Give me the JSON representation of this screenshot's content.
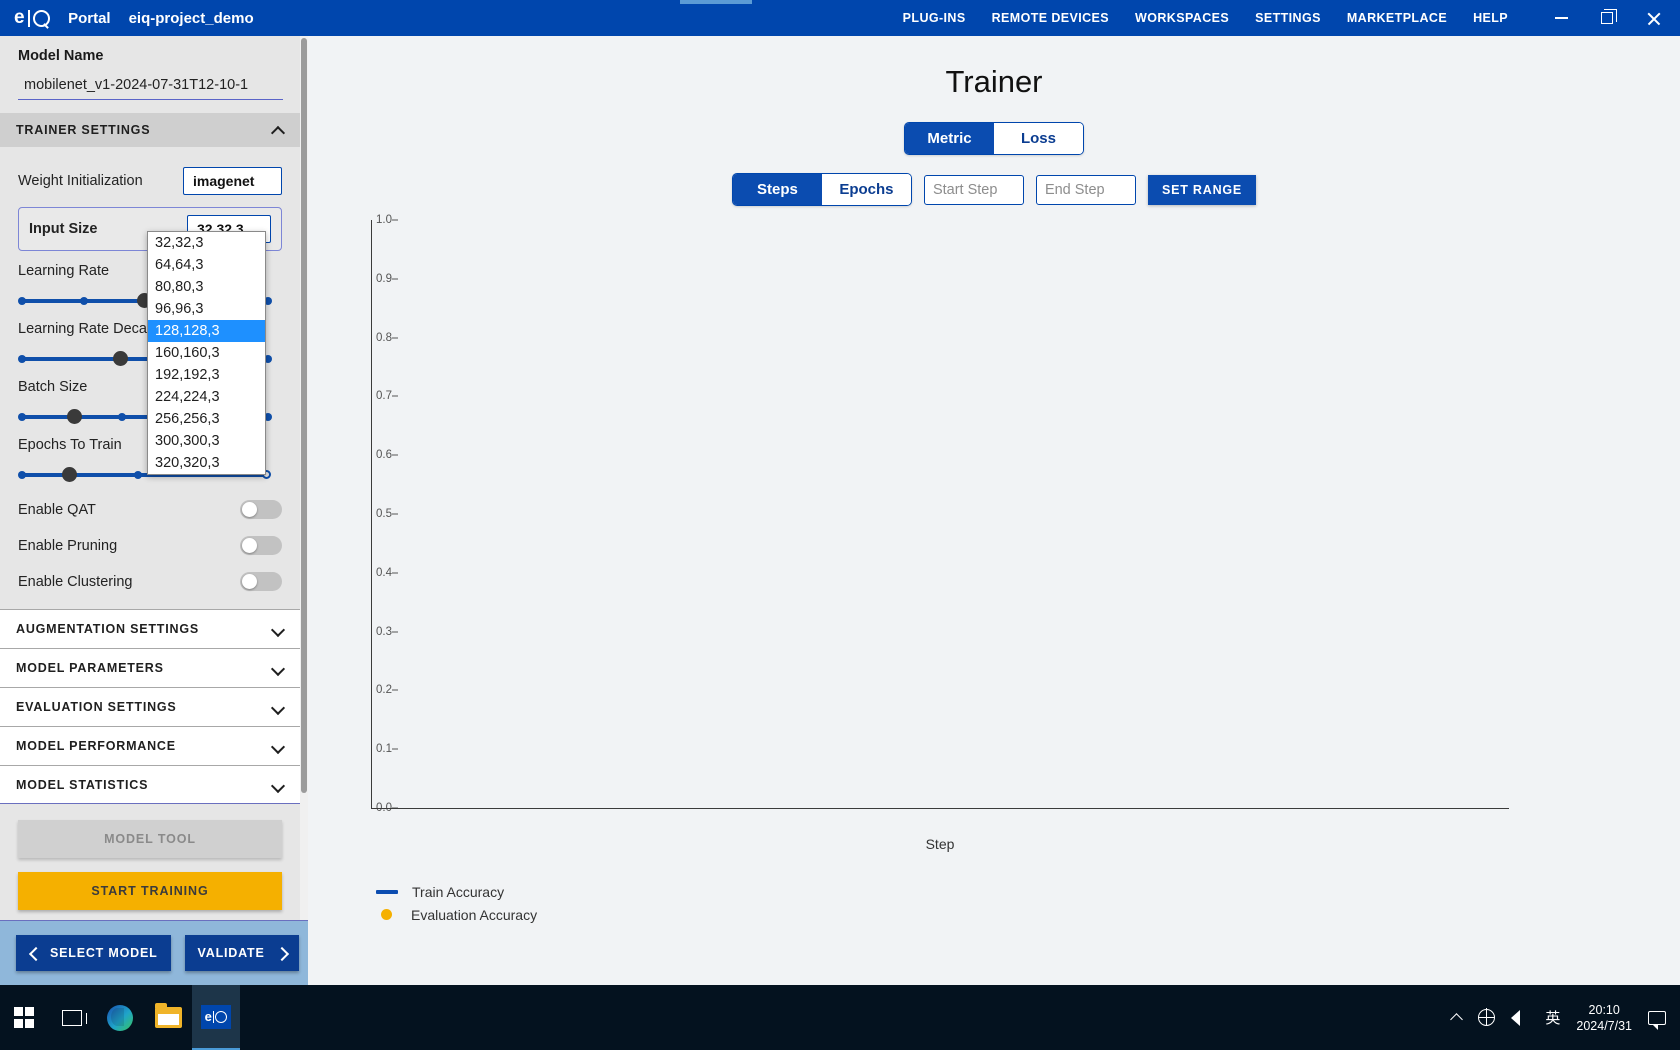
{
  "titlebar": {
    "logo_text": "eIQ",
    "product": "Portal",
    "project": "eiq-project_demo",
    "nav_items": [
      "PLUG-INS",
      "REMOTE DEVICES",
      "WORKSPACES",
      "SETTINGS",
      "MARKETPLACE",
      "HELP"
    ],
    "window_controls": [
      "minimize-icon",
      "restore-icon",
      "close-icon"
    ]
  },
  "sidebar": {
    "model_name_label": "Model Name",
    "model_name_value": "mobilenet_v1-2024-07-31T12-10-1",
    "trainer_settings_header": "TRAINER SETTINGS",
    "weight_init_label": "Weight Initialization",
    "weight_init_value": "imagenet",
    "input_size_label": "Input Size",
    "input_size_value": "32,32,3",
    "input_size_options": [
      "32,32,3",
      "64,64,3",
      "80,80,3",
      "96,96,3",
      "128,128,3",
      "160,160,3",
      "192,192,3",
      "224,224,3",
      "256,256,3",
      "300,300,3",
      "320,320,3"
    ],
    "input_size_highlighted": "128,128,3",
    "sliders": [
      {
        "label": "Learning Rate"
      },
      {
        "label": "Learning Rate Decay"
      },
      {
        "label": "Batch Size"
      },
      {
        "label": "Epochs To Train"
      }
    ],
    "toggles": [
      {
        "label": "Enable QAT",
        "on": false
      },
      {
        "label": "Enable Pruning",
        "on": false
      },
      {
        "label": "Enable Clustering",
        "on": false
      }
    ],
    "accordions": [
      "AUGMENTATION SETTINGS",
      "MODEL PARAMETERS",
      "EVALUATION SETTINGS",
      "MODEL PERFORMANCE",
      "MODEL STATISTICS"
    ],
    "model_tool_label": "MODEL TOOL",
    "start_training_label": "START TRAINING",
    "select_model_label": "SELECT MODEL",
    "validate_label": "VALIDATE"
  },
  "main": {
    "title": "Trainer",
    "metric_loss": {
      "options": [
        "Metric",
        "Loss"
      ],
      "selected": "Metric"
    },
    "steps_epochs": {
      "options": [
        "Steps",
        "Epochs"
      ],
      "selected": "Steps"
    },
    "start_step_placeholder": "Start Step",
    "start_step_value": "",
    "end_step_placeholder": "End Step",
    "end_step_value": "",
    "set_range_label": "SET RANGE"
  },
  "chart_data": {
    "type": "line",
    "title": "",
    "xlabel": "Step",
    "ylabel": "",
    "ylim": [
      0.0,
      1.0
    ],
    "yticks": [
      "1.0",
      "0.9",
      "0.8",
      "0.7",
      "0.6",
      "0.5",
      "0.4",
      "0.3",
      "0.2",
      "0.1",
      "0.0"
    ],
    "xticks": [],
    "grid": false,
    "legend_position": "bottom-left",
    "series": [
      {
        "name": "Train Accuracy",
        "color": "#0b4cb0",
        "marker": "line",
        "x": [],
        "values": []
      },
      {
        "name": "Evaluation Accuracy",
        "color": "#f5b000",
        "marker": "dot",
        "x": [],
        "values": []
      }
    ]
  },
  "taskbar": {
    "items": [
      "start-icon",
      "task-view-icon",
      "edge-icon",
      "file-explorer-icon",
      "eiq-icon"
    ],
    "tray": [
      "chevron-up-icon",
      "network-icon",
      "volume-icon"
    ],
    "ime": "英",
    "time": "20:10",
    "date": "2024/7/31"
  }
}
